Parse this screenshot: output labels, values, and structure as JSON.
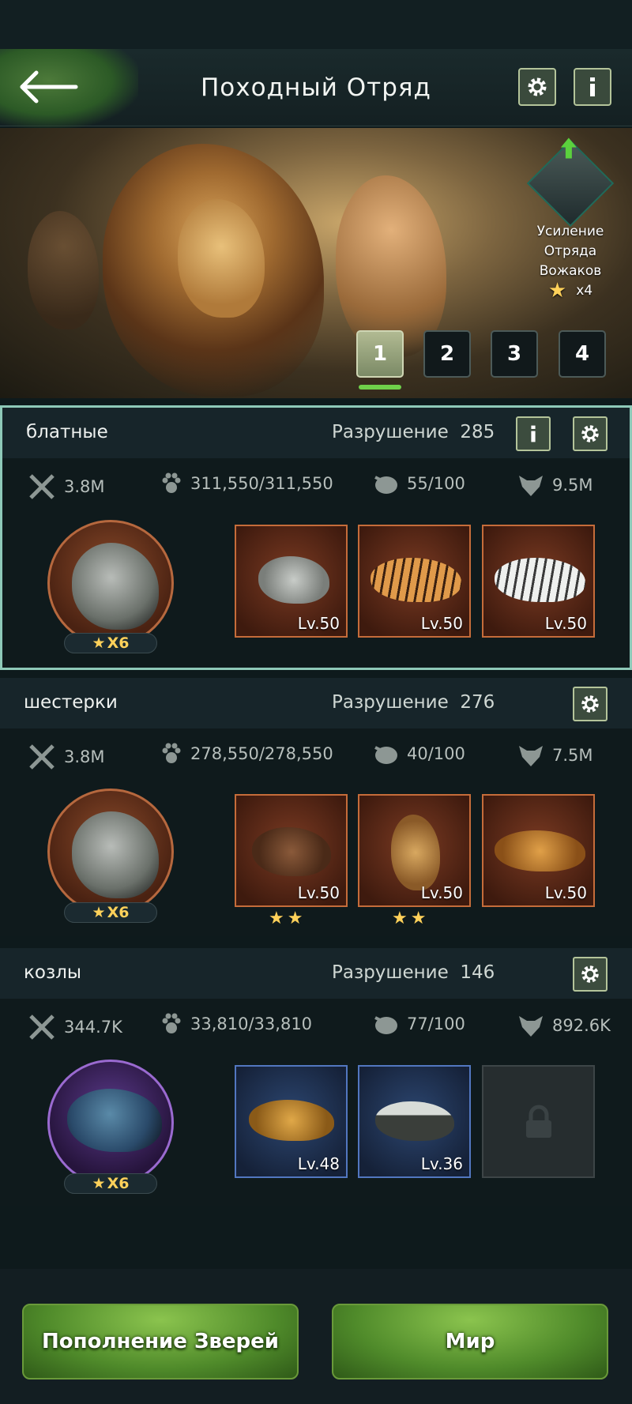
{
  "header": {
    "title": "Походный Отряд"
  },
  "boost": {
    "line1": "Усиление",
    "line2": "Отряда",
    "line3": "Вожаков",
    "count": "x4"
  },
  "pages": [
    "1",
    "2",
    "3",
    "4"
  ],
  "active_page": "1",
  "squads": [
    {
      "name": "блатные",
      "destruction_label": "Разрушение",
      "destruction_value": "285",
      "stats": {
        "power": "3.8M",
        "troops": "311,550/311,550",
        "load": "55/100",
        "strength": "9.5M"
      },
      "leader_stars": "X6",
      "beasts": [
        {
          "level": "Lv.50",
          "stars": ""
        },
        {
          "level": "Lv.50",
          "stars": ""
        },
        {
          "level": "Lv.50",
          "stars": ""
        }
      ]
    },
    {
      "name": "шестерки",
      "destruction_label": "Разрушение",
      "destruction_value": "276",
      "stats": {
        "power": "3.8M",
        "troops": "278,550/278,550",
        "load": "40/100",
        "strength": "7.5M"
      },
      "leader_stars": "X6",
      "beasts": [
        {
          "level": "Lv.50",
          "stars": "★★"
        },
        {
          "level": "Lv.50",
          "stars": "★★"
        },
        {
          "level": "Lv.50",
          "stars": ""
        }
      ]
    },
    {
      "name": "козлы",
      "destruction_label": "Разрушение",
      "destruction_value": "146",
      "stats": {
        "power": "344.7K",
        "troops": "33,810/33,810",
        "load": "77/100",
        "strength": "892.6K"
      },
      "leader_stars": "X6",
      "beasts": [
        {
          "level": "Lv.48",
          "stars": ""
        },
        {
          "level": "Lv.36",
          "stars": ""
        }
      ]
    }
  ],
  "buttons": {
    "replenish": "Пополнение Зверей",
    "world": "Мир"
  },
  "colors": {
    "accent_green": "#6fd04a",
    "star_gold": "#ffd15a",
    "frame_orange": "#c56c3a",
    "frame_blue": "#5277c0"
  }
}
